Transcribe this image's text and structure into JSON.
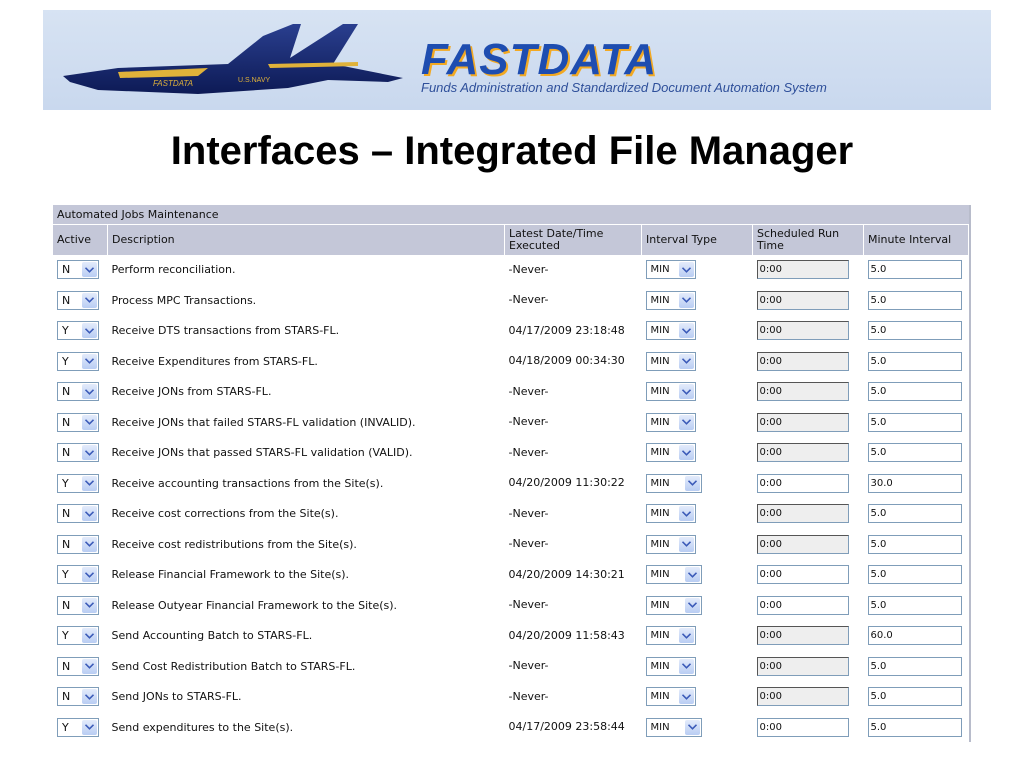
{
  "banner": {
    "logo_text": "FASTDATA",
    "tagline": "Funds Administration and Standardized Document Automation System",
    "jet_markings": [
      "FASTDATA",
      "U.S.NAVY"
    ]
  },
  "slide": {
    "title": "Interfaces – Integrated File Manager"
  },
  "panel": {
    "title": "Automated Jobs Maintenance",
    "columns": {
      "active": "Active",
      "description": "Description",
      "latest": "Latest Date/Time Executed",
      "interval_type": "Interval Type",
      "scheduled": "Scheduled Run Time",
      "minute_interval": "Minute Interval"
    },
    "rows": [
      {
        "active": "N",
        "description": "Perform reconciliation.",
        "latest": "-Never-",
        "interval": "MIN",
        "scheduled": "0:00",
        "minute": "5.0"
      },
      {
        "active": "N",
        "description": "Process MPC Transactions.",
        "latest": "-Never-",
        "interval": "MIN",
        "scheduled": "0:00",
        "minute": "5.0"
      },
      {
        "active": "Y",
        "description": "Receive DTS transactions from STARS-FL.",
        "latest": "04/17/2009 23:18:48",
        "interval": "MIN",
        "scheduled": "0:00",
        "minute": "5.0"
      },
      {
        "active": "Y",
        "description": "Receive Expenditures from STARS-FL.",
        "latest": "04/18/2009 00:34:30",
        "interval": "MIN",
        "scheduled": "0:00",
        "minute": "5.0"
      },
      {
        "active": "N",
        "description": "Receive JONs from STARS-FL.",
        "latest": "-Never-",
        "interval": "MIN",
        "scheduled": "0:00",
        "minute": "5.0"
      },
      {
        "active": "N",
        "description": "Receive JONs that failed STARS-FL validation (INVALID).",
        "latest": "-Never-",
        "interval": "MIN",
        "scheduled": "0:00",
        "minute": "5.0"
      },
      {
        "active": "N",
        "description": "Receive JONs that passed STARS-FL validation (VALID).",
        "latest": "-Never-",
        "interval": "MIN",
        "scheduled": "0:00",
        "minute": "5.0"
      },
      {
        "active": "Y",
        "description": "Receive accounting transactions from the Site(s).",
        "latest": "04/20/2009 11:30:22",
        "interval": "MIN",
        "scheduled": "0:00",
        "minute": "30.0"
      },
      {
        "active": "N",
        "description": "Receive cost corrections from the Site(s).",
        "latest": "-Never-",
        "interval": "MIN",
        "scheduled": "0:00",
        "minute": "5.0"
      },
      {
        "active": "N",
        "description": "Receive cost redistributions from the Site(s).",
        "latest": "-Never-",
        "interval": "MIN",
        "scheduled": "0:00",
        "minute": "5.0"
      },
      {
        "active": "Y",
        "description": "Release Financial Framework to the Site(s).",
        "latest": "04/20/2009 14:30:21",
        "interval": "MIN",
        "scheduled": "0:00",
        "minute": "5.0"
      },
      {
        "active": "N",
        "description": "Release Outyear Financial Framework to the Site(s).",
        "latest": "-Never-",
        "interval": "MIN",
        "scheduled": "0:00",
        "minute": "5.0"
      },
      {
        "active": "Y",
        "description": "Send Accounting Batch to STARS-FL.",
        "latest": "04/20/2009 11:58:43",
        "interval": "MIN",
        "scheduled": "0:00",
        "minute": "60.0"
      },
      {
        "active": "N",
        "description": "Send Cost Redistribution Batch to STARS-FL.",
        "latest": "-Never-",
        "interval": "MIN",
        "scheduled": "0:00",
        "minute": "5.0"
      },
      {
        "active": "N",
        "description": "Send JONs to STARS-FL.",
        "latest": "-Never-",
        "interval": "MIN",
        "scheduled": "0:00",
        "minute": "5.0"
      },
      {
        "active": "Y",
        "description": "Send expenditures to the Site(s).",
        "latest": "04/17/2009 23:58:44",
        "interval": "MIN",
        "scheduled": "0:00",
        "minute": "5.0"
      }
    ]
  }
}
